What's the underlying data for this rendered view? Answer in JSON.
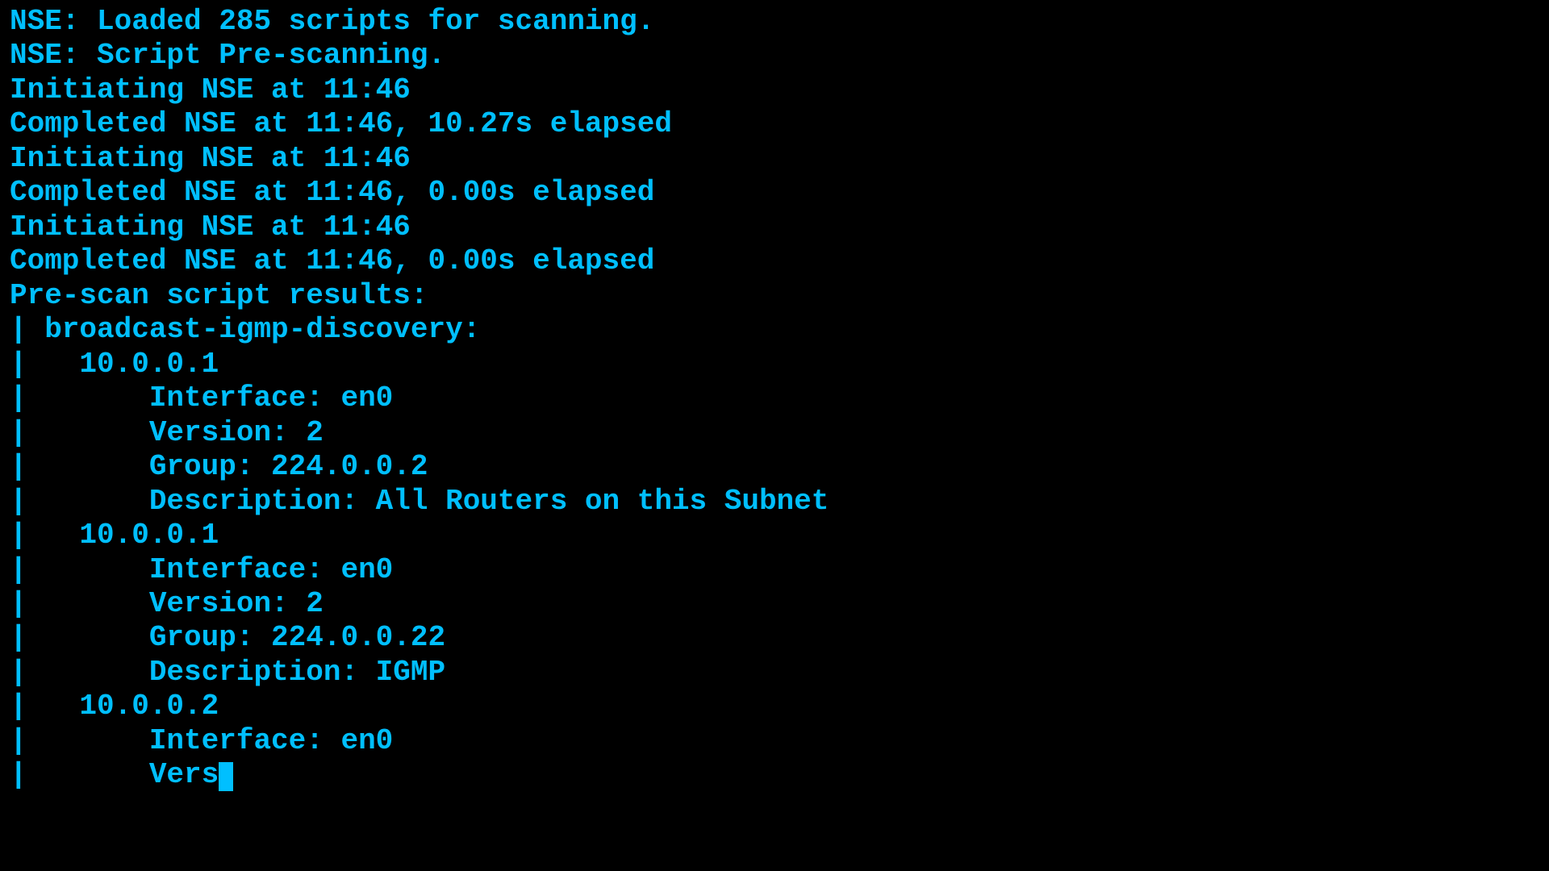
{
  "terminal": {
    "lines": [
      "NSE: Loaded 285 scripts for scanning.",
      "NSE: Script Pre-scanning.",
      "Initiating NSE at 11:46",
      "Completed NSE at 11:46, 10.27s elapsed",
      "Initiating NSE at 11:46",
      "Completed NSE at 11:46, 0.00s elapsed",
      "Initiating NSE at 11:46",
      "Completed NSE at 11:46, 0.00s elapsed",
      "Pre-scan script results:",
      "| broadcast-igmp-discovery:",
      "|   10.0.0.1",
      "|       Interface: en0",
      "|       Version: 2",
      "|       Group: 224.0.0.2",
      "|       Description: All Routers on this Subnet",
      "|   10.0.0.1",
      "|       Interface: en0",
      "|       Version: 2",
      "|       Group: 224.0.0.22",
      "|       Description: IGMP",
      "|   10.0.0.2",
      "|       Interface: en0",
      "|       Vers"
    ],
    "cursor_line": "|       Vers"
  }
}
